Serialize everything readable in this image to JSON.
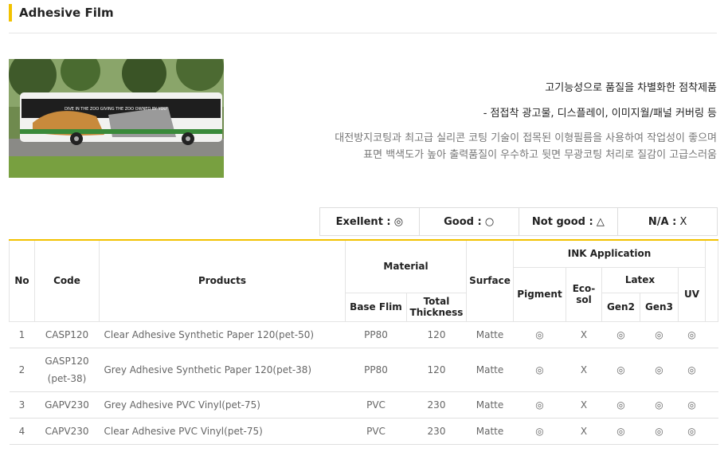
{
  "page_title": "Adhesive Film",
  "intro": {
    "headline": "고기능성으로 품질을 차별화한 점착제품",
    "uses": "- 점접착 광고물, 디스플레이, 이미지월/패널 커버링 등",
    "desc_line1": "대전방지코팅과 최고급 실리콘 코팅 기술이 접목된 이형필름을 사용하여 작업성이 좋으며",
    "desc_line2": "표면 백색도가 높아 출력품질이 우수하고 뒷면 무광코팅 처리로 질감이 고급스러움"
  },
  "image_banner_text": "DIVE IN THE ZOO GIVING THE ZOO OWNED BY YOU",
  "legend": {
    "excellent_label": "Exellent :",
    "excellent_symbol": "◎",
    "good_label": "Good :",
    "good_symbol": "○",
    "notgood_label": "Not good :",
    "notgood_symbol": "△",
    "na_label": "N/A :",
    "na_symbol": "X"
  },
  "table": {
    "headers": {
      "no": "No",
      "code": "Code",
      "products": "Products",
      "material": "Material",
      "base_film": "Base Flim",
      "total_thickness": "Total Thickness",
      "surface": "Surface",
      "ink_application": "INK Application",
      "pigment": "Pigment",
      "eco_sol": "Eco-sol",
      "latex": "Latex",
      "gen2": "Gen2",
      "gen3": "Gen3",
      "uv": "UV"
    },
    "rows": [
      {
        "no": "1",
        "code": "CASP120",
        "product": "Clear Adhesive Synthetic Paper 120(pet-50)",
        "base": "PP80",
        "thickness": "120",
        "surface": "Matte",
        "pigment": "◎",
        "ecosol": "X",
        "gen2": "◎",
        "gen3": "◎",
        "uv": "◎"
      },
      {
        "no": "2",
        "code": "GASP120 (pet-38)",
        "product": "Grey Adhesive Synthetic Paper 120(pet-38)",
        "base": "PP80",
        "thickness": "120",
        "surface": "Matte",
        "pigment": "◎",
        "ecosol": "X",
        "gen2": "◎",
        "gen3": "◎",
        "uv": "◎"
      },
      {
        "no": "3",
        "code": "GAPV230",
        "product": "Grey Adhesive PVC Vinyl(pet-75)",
        "base": "PVC",
        "thickness": "230",
        "surface": "Matte",
        "pigment": "◎",
        "ecosol": "X",
        "gen2": "◎",
        "gen3": "◎",
        "uv": "◎"
      },
      {
        "no": "4",
        "code": "CAPV230",
        "product": "Clear Adhesive PVC Vinyl(pet-75)",
        "base": "PVC",
        "thickness": "230",
        "surface": "Matte",
        "pigment": "◎",
        "ecosol": "X",
        "gen2": "◎",
        "gen3": "◎",
        "uv": "◎"
      }
    ]
  }
}
